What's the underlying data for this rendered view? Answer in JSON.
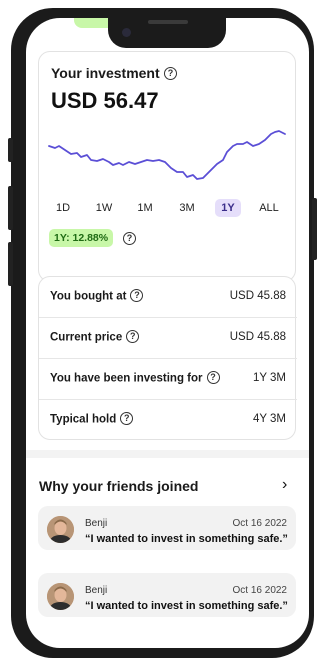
{
  "investment": {
    "title": "Your investment",
    "amount": "USD 56.47",
    "periods": [
      "1D",
      "1W",
      "1M",
      "3M",
      "1Y",
      "ALL"
    ],
    "active_period": "1Y",
    "performance_badge": "1Y: 12.88%",
    "chart_color": "#5b4fd6"
  },
  "details": [
    {
      "label": "You bought at",
      "value": "USD 45.88"
    },
    {
      "label": "Current price",
      "value": "USD 45.88"
    },
    {
      "label": "You have been investing for",
      "value": "1Y 3M"
    },
    {
      "label": "Typical hold",
      "value": "4Y 3M"
    }
  ],
  "friends": {
    "title": "Why your friends joined",
    "testimonials": [
      {
        "name": "Benji",
        "date": "Oct 16 2022",
        "quote": "“I wanted to invest in something safe.”"
      },
      {
        "name": "Benji",
        "date": "Oct 16 2022",
        "quote": "“I wanted to invest in something safe.”"
      }
    ]
  },
  "colors": {
    "accent_green": "#c8f7a8",
    "accent_purple": "#e5defa"
  },
  "icons": [
    "help-circle-icon",
    "chevron-right-icon",
    "avatar-photo"
  ]
}
